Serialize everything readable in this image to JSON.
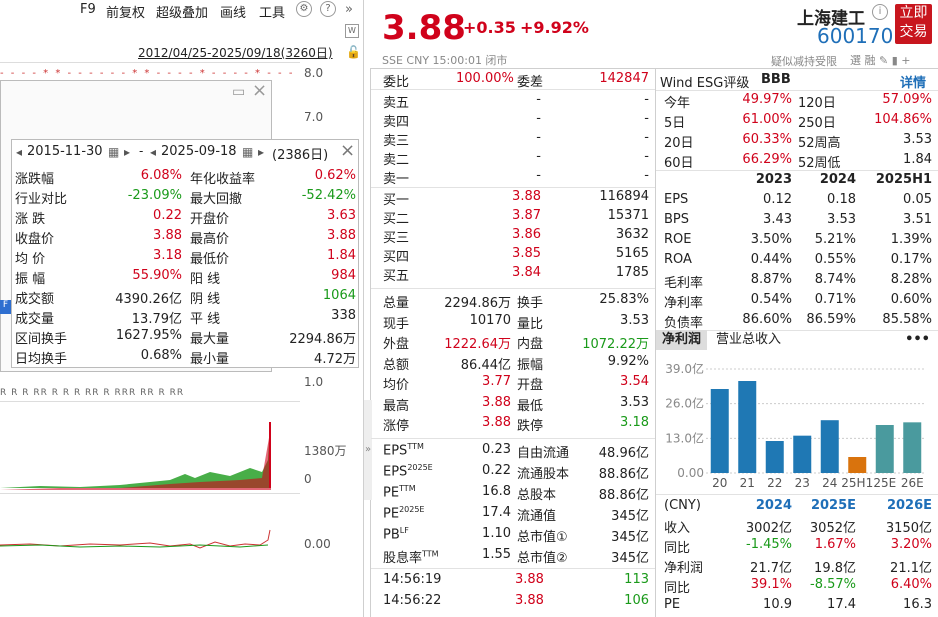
{
  "toolbar": {
    "f9": "F9",
    "restore": "前复权",
    "overlay": "超级叠加",
    "draw": "画线",
    "tools": "工具"
  },
  "range_label": "2012/04/25-2025/09/18(3260日)",
  "axis": {
    "p1": "8.0",
    "p2": "7.0",
    "p3": "1.0",
    "vol": "1380万",
    "vol0": "0",
    "macd": "0.00"
  },
  "stats": {
    "date_start": "2015-11-30",
    "date_sep": "-",
    "date_end": "2025-09-18",
    "days": "(2386日)",
    "rows": [
      {
        "l1": "涨跌幅",
        "v1": "6.08%",
        "l2": "年化收益率",
        "v2": "0.62%"
      },
      {
        "l1": "行业对比",
        "v1": "-23.09%",
        "l2": "最大回撤",
        "v2": "-52.42%"
      },
      {
        "l1": "涨  跌",
        "v1": "0.22",
        "l2": "开盘价",
        "v2": "3.63"
      },
      {
        "l1": "收盘价",
        "v1": "3.88",
        "l2": "最高价",
        "v2": "3.88"
      },
      {
        "l1": "均  价",
        "v1": "3.18",
        "l2": "最低价",
        "v2": "1.84"
      },
      {
        "l1": "振  幅",
        "v1": "55.90%",
        "l2": "阳  线",
        "v2": "984"
      },
      {
        "l1": "成交额",
        "v1": "4390.26亿",
        "l2": "阴  线",
        "v2": "1064"
      },
      {
        "l1": "成交量",
        "v1": "13.79亿",
        "l2": "平  线",
        "v2": "338"
      },
      {
        "l1": "区间换手",
        "v1": "1627.95%",
        "l2": "最大量",
        "v2": "2294.86万"
      },
      {
        "l1": "日均换手",
        "v1": "0.68%",
        "l2": "最小量",
        "v2": "4.72万"
      }
    ]
  },
  "quote": {
    "price": "3.88",
    "change": "+0.35",
    "pct": "+9.92%",
    "name": "上海建工",
    "code": "600170",
    "btn1": "立即",
    "btn2": "交易",
    "meta": "SSE  CNY  15:00:01  闭市",
    "note": "疑似减持受限"
  },
  "book": {
    "wb_label": "委比",
    "wb": "100.00%",
    "wc_label": "委差",
    "wc": "142847",
    "sells": [
      {
        "l": "卖五",
        "p": "-",
        "v": "-"
      },
      {
        "l": "卖四",
        "p": "-",
        "v": "-"
      },
      {
        "l": "卖三",
        "p": "-",
        "v": "-"
      },
      {
        "l": "卖二",
        "p": "-",
        "v": "-"
      },
      {
        "l": "卖一",
        "p": "-",
        "v": "-"
      }
    ],
    "buys": [
      {
        "l": "买一",
        "p": "3.88",
        "v": "116894"
      },
      {
        "l": "买二",
        "p": "3.87",
        "v": "15371"
      },
      {
        "l": "买三",
        "p": "3.86",
        "v": "3632"
      },
      {
        "l": "买四",
        "p": "3.85",
        "v": "5165"
      },
      {
        "l": "买五",
        "p": "3.84",
        "v": "1785"
      }
    ]
  },
  "summary": [
    {
      "l1": "总量",
      "v1": "2294.86万",
      "l2": "换手",
      "v2": "25.83%"
    },
    {
      "l1": "现手",
      "v1": "10170",
      "l2": "量比",
      "v2": "3.53"
    },
    {
      "l1": "外盘",
      "v1": "1222.64万",
      "l2": "内盘",
      "v2": "1072.22万"
    },
    {
      "l1": "总额",
      "v1": "86.44亿",
      "l2": "振幅",
      "v2": "9.92%"
    },
    {
      "l1": "均价",
      "v1": "3.77",
      "l2": "开盘",
      "v2": "3.54"
    },
    {
      "l1": "最高",
      "v1": "3.88",
      "l2": "最低",
      "v2": "3.53"
    },
    {
      "l1": "涨停",
      "v1": "3.88",
      "l2": "跌停",
      "v2": "3.18"
    }
  ],
  "valuation": [
    {
      "l1": "EPS",
      "s1": "TTM",
      "v1": "0.23",
      "l2": "自由流通",
      "v2": "48.96亿"
    },
    {
      "l1": "EPS",
      "s1": "2025E",
      "v1": "0.22",
      "l2": "流通股本",
      "v2": "88.86亿"
    },
    {
      "l1": "PE",
      "s1": "TTM",
      "v1": "16.8",
      "l2": "总股本",
      "v2": "88.86亿"
    },
    {
      "l1": "PE",
      "s1": "2025E",
      "v1": "17.4",
      "l2": "流通值",
      "v2": "345亿"
    },
    {
      "l1": "PB",
      "s1": "LF",
      "v1": "1.10",
      "l2": "总市值①",
      "v2": "345亿"
    },
    {
      "l1": "股息率",
      "s1": "TTM",
      "v1": "1.55",
      "l2": "总市值②",
      "v2": "345亿"
    }
  ],
  "ticks": [
    {
      "t": "14:56:19",
      "p": "3.88",
      "v": "113"
    },
    {
      "t": "14:56:22",
      "p": "3.88",
      "v": "106"
    }
  ],
  "esg": {
    "label": "Wind ESG评级",
    "grade": "BBB",
    "detail": "详情"
  },
  "perf": [
    {
      "l1": "今年",
      "v1": "49.97%",
      "l2": "120日",
      "v2": "57.09%"
    },
    {
      "l1": "5日",
      "v1": "61.00%",
      "l2": "250日",
      "v2": "104.86%"
    },
    {
      "l1": "20日",
      "v1": "60.33%",
      "l2": "52周高",
      "v2": "3.53"
    },
    {
      "l1": "60日",
      "v1": "66.29%",
      "l2": "52周低",
      "v2": "1.84"
    }
  ],
  "fin": {
    "years": [
      "2023",
      "2024",
      "2025H1"
    ],
    "rows": [
      {
        "l": "EPS",
        "v": [
          "0.12",
          "0.18",
          "0.05"
        ]
      },
      {
        "l": "BPS",
        "v": [
          "3.43",
          "3.53",
          "3.51"
        ]
      },
      {
        "l": "ROE",
        "v": [
          "3.50%",
          "5.21%",
          "1.39%"
        ]
      },
      {
        "l": "ROA",
        "v": [
          "0.44%",
          "0.55%",
          "0.17%"
        ]
      },
      {
        "l": "毛利率",
        "v": [
          "8.87%",
          "8.74%",
          "8.28%"
        ]
      },
      {
        "l": "净利率",
        "v": [
          "0.54%",
          "0.71%",
          "0.60%"
        ]
      },
      {
        "l": "负债率",
        "v": [
          "86.60%",
          "86.59%",
          "85.58%"
        ]
      }
    ]
  },
  "tabs": {
    "t1": "净利润",
    "t2": "营业总收入",
    "more": "•••"
  },
  "chart_data": {
    "type": "bar",
    "categories": [
      "20",
      "21",
      "22",
      "23",
      "24",
      "25H1",
      "25E",
      "26E"
    ],
    "values": [
      31.5,
      34.5,
      12.0,
      14.0,
      19.8,
      6.0,
      18.0,
      19.0
    ],
    "ylim": [
      0,
      39
    ],
    "yticks": [
      "39.0亿",
      "26.0亿",
      "13.0亿",
      "0.00"
    ],
    "colors": {
      "actual": "#1f78b4",
      "partial": "#d9730d",
      "estimate": "#4a9a9e"
    }
  },
  "forecast": {
    "header": [
      "(CNY)",
      "2024",
      "2025E",
      "2026E"
    ],
    "rows": [
      {
        "l": "收入",
        "v": [
          "3002亿",
          "3052亿",
          "3150亿"
        ]
      },
      {
        "l": "同比",
        "v": [
          "-1.45%",
          "1.67%",
          "3.20%"
        ]
      },
      {
        "l": "净利润",
        "v": [
          "21.7亿",
          "19.8亿",
          "21.1亿"
        ]
      },
      {
        "l": "同比",
        "v": [
          "39.1%",
          "-8.57%",
          "6.40%"
        ]
      },
      {
        "l": "PE",
        "v": [
          "10.9",
          "17.4",
          "16.3"
        ]
      }
    ]
  }
}
